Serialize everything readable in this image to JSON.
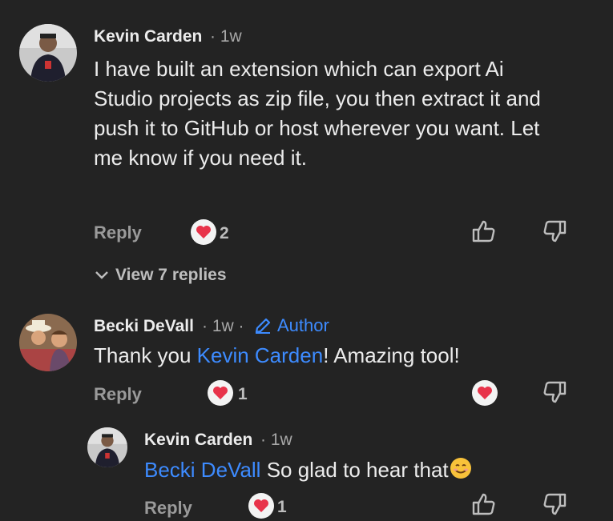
{
  "comments": [
    {
      "author": "Kevin Carden",
      "time": "· 1w",
      "body": "I have built an extension which can export Ai Studio projects as zip file, you then extract it and push it to GitHub or host wherever you want. Let me know if you need it.",
      "reply_label": "Reply",
      "likes": "2",
      "view_replies": "View 7 replies"
    },
    {
      "author": "Becki DeVall",
      "time": "· 1w ·",
      "badge": "Author",
      "mention": "Kevin Carden",
      "body_before": "Thank you ",
      "body_after": "! Amazing tool!",
      "reply_label": "Reply",
      "likes": "1"
    },
    {
      "author": "Kevin Carden",
      "time": "· 1w",
      "mention": "Becki DeVall",
      "body_after": " So glad to hear that",
      "reply_label": "Reply",
      "likes": "1"
    }
  ],
  "colors": {
    "background": "#232323",
    "mention": "#3d8bff",
    "heart": "#e8334a"
  },
  "icons": {
    "like": "heart-icon",
    "thumbs_up": "thumbs-up-icon",
    "thumbs_down": "thumbs-down-icon",
    "expand": "chevron-down-icon",
    "author": "pencil-icon",
    "emoji": "smiling-face-emoji"
  }
}
